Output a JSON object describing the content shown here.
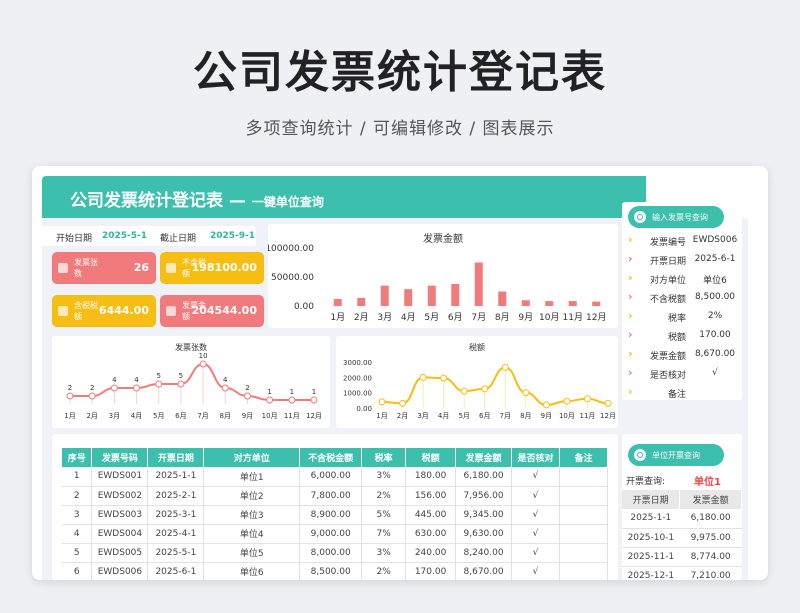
{
  "hero": {
    "title": "公司发票统计登记表",
    "subtitle": "多项查询统计 /  可编辑修改  / 图表展示"
  },
  "banner": {
    "title": "公司发票统计登记表 —",
    "subtitle": "一键单位查询"
  },
  "dates": {
    "start_label": "开始日期",
    "start_value": "2025-5-1",
    "end_label": "截止日期",
    "end_value": "2025-9-1"
  },
  "cards": [
    {
      "label": "发票张数",
      "value": "26",
      "color": "#f17a7d"
    },
    {
      "label": "不含税额",
      "value": "198100.00",
      "color": "#f6bd12"
    },
    {
      "label": "含税税额",
      "value": "6444.00",
      "color": "#f6bd12"
    },
    {
      "label": "发票金额",
      "value": "204544.00",
      "color": "#f17a7d"
    }
  ],
  "chart_data": [
    {
      "type": "bar",
      "title": "发票金额",
      "categories": [
        "1月",
        "2月",
        "3月",
        "4月",
        "5月",
        "6月",
        "7月",
        "8月",
        "9月",
        "10月",
        "11月",
        "12月"
      ],
      "values": [
        12000,
        14000,
        35000,
        29000,
        35000,
        38000,
        75000,
        25000,
        10000,
        8500,
        8500,
        7500
      ],
      "ylim": [
        0,
        100000
      ],
      "yticks": [
        "100000.00",
        "50000.00",
        "0.00"
      ],
      "color": "#f17a7d"
    },
    {
      "type": "line",
      "title": "发票张数",
      "categories": [
        "1月",
        "2月",
        "3月",
        "4月",
        "5月",
        "6月",
        "7月",
        "8月",
        "9月",
        "10月",
        "11月",
        "12月"
      ],
      "values": [
        2,
        2,
        4,
        4,
        5,
        5,
        10,
        4,
        2,
        1,
        1,
        1
      ],
      "ylim": [
        0,
        12
      ],
      "color": "#f17a7d"
    },
    {
      "type": "line",
      "title": "税额",
      "categories": [
        "1月",
        "2月",
        "3月",
        "4月",
        "5月",
        "6月",
        "7月",
        "8月",
        "9月",
        "10月",
        "11月",
        "12月"
      ],
      "values": [
        400,
        300,
        2000,
        1950,
        1100,
        1250,
        2650,
        1000,
        200,
        450,
        600,
        300
      ],
      "ylim": [
        0,
        3000
      ],
      "yticks": [
        "3000.00",
        "2000.00",
        "1000.00",
        "0.00"
      ],
      "color": "#f6bd12"
    }
  ],
  "search": {
    "button": "输入发票号查询",
    "rows": [
      {
        "key": "发票编号",
        "value": "EWDS006",
        "chev": "#f6bd12"
      },
      {
        "key": "开票日期",
        "value": "2025-6-1",
        "chev": "#f17a7d"
      },
      {
        "key": "对方单位",
        "value": "单位6",
        "chev": "#f6bd12"
      },
      {
        "key": "不含税额",
        "value": "8,500.00",
        "chev": "#f17a7d"
      },
      {
        "key": "税率",
        "value": "2%",
        "chev": "#f6bd12"
      },
      {
        "key": "税额",
        "value": "170.00",
        "chev": "#f17a7d"
      },
      {
        "key": "发票金额",
        "value": "8,670.00",
        "chev": "#f6bd12"
      },
      {
        "key": "是否核对",
        "value": "√",
        "chev": "#f17a7d"
      },
      {
        "key": "备注",
        "value": "",
        "chev": "#f6bd12"
      }
    ]
  },
  "table": {
    "headers": [
      "序号",
      "发票号码",
      "开票日期",
      "对方单位",
      "不含税金额",
      "税率",
      "税额",
      "发票金额",
      "是否核对",
      "备注"
    ],
    "rows": [
      [
        "1",
        "EWDS001",
        "2025-1-1",
        "单位1",
        "6,000.00",
        "3%",
        "180.00",
        "6,180.00",
        "√",
        ""
      ],
      [
        "2",
        "EWDS002",
        "2025-2-1",
        "单位2",
        "7,800.00",
        "2%",
        "156.00",
        "7,956.00",
        "√",
        ""
      ],
      [
        "3",
        "EWDS003",
        "2025-3-1",
        "单位3",
        "8,900.00",
        "5%",
        "445.00",
        "9,345.00",
        "√",
        ""
      ],
      [
        "4",
        "EWDS004",
        "2025-4-1",
        "单位4",
        "9,000.00",
        "7%",
        "630.00",
        "9,630.00",
        "√",
        ""
      ],
      [
        "5",
        "EWDS005",
        "2025-5-1",
        "单位5",
        "8,000.00",
        "3%",
        "240.00",
        "8,240.00",
        "√",
        ""
      ],
      [
        "6",
        "EWDS006",
        "2025-6-1",
        "单位6",
        "8,500.00",
        "2%",
        "170.00",
        "8,670.00",
        "√",
        ""
      ]
    ]
  },
  "unit_query": {
    "button": "单位开票查询",
    "label": "开票查询:",
    "value": "单位1",
    "headers": [
      "开票日期",
      "发票金额"
    ],
    "rows": [
      [
        "2025-1-1",
        "6,180.00"
      ],
      [
        "2025-10-1",
        "9,975.00"
      ],
      [
        "2025-11-1",
        "8,774.00"
      ],
      [
        "2025-12-1",
        "7,210.00"
      ]
    ]
  }
}
